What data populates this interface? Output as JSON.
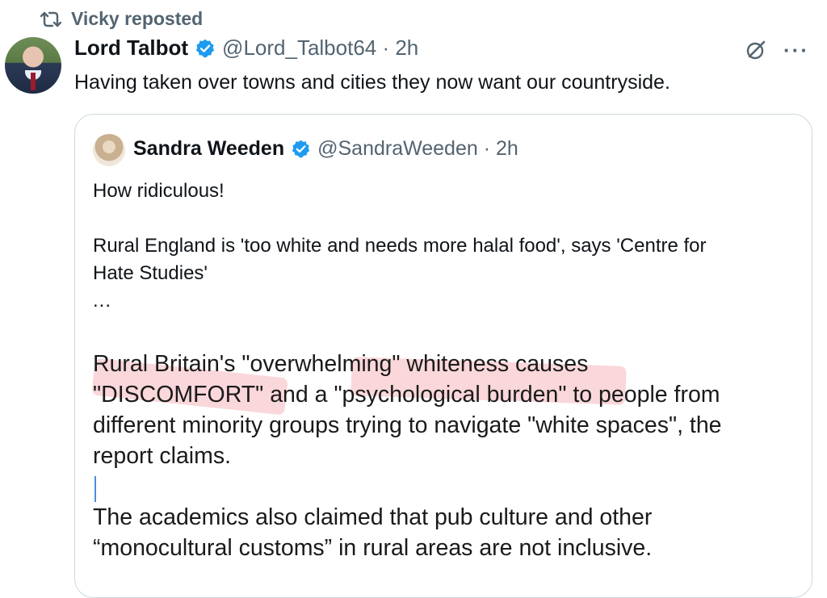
{
  "repost": {
    "icon": "repost-icon",
    "label": "Vicky reposted"
  },
  "tweet": {
    "author_name": "Lord Talbot",
    "verified": true,
    "handle_time": "@Lord_Talbot64 · 2h",
    "text": "Having taken over towns and cities they now want our countryside.",
    "actions": {
      "grok_icon": "grok-icon",
      "more_label": "···"
    }
  },
  "quote": {
    "author_name": "Sandra Weeden",
    "verified": true,
    "handle_time": "@SandraWeeden · 2h",
    "line1": "How ridiculous!",
    "line2": "Rural England is 'too white and needs more halal food', says 'Centre for",
    "line3": "Hate Studies'",
    "ellipsis": "...",
    "article": {
      "p1_l1": "Rural Britain's \"overwhelming\" whiteness causes",
      "p1_l2": "\"DISCOMFORT\" and a \"psychological burden\" to people from",
      "p1_l3": "different minority groups trying to navigate \"white spaces\", the",
      "p1_l4": "report claims.",
      "p2_l1": "The academics also claimed that pub culture and other",
      "p2_l2": "“monocultural customs” in rural areas are not inclusive."
    }
  },
  "colors": {
    "verified_blue": "#1d9bf0",
    "muted": "#536471",
    "border": "#cfd9de",
    "highlight": "#f08c96"
  }
}
